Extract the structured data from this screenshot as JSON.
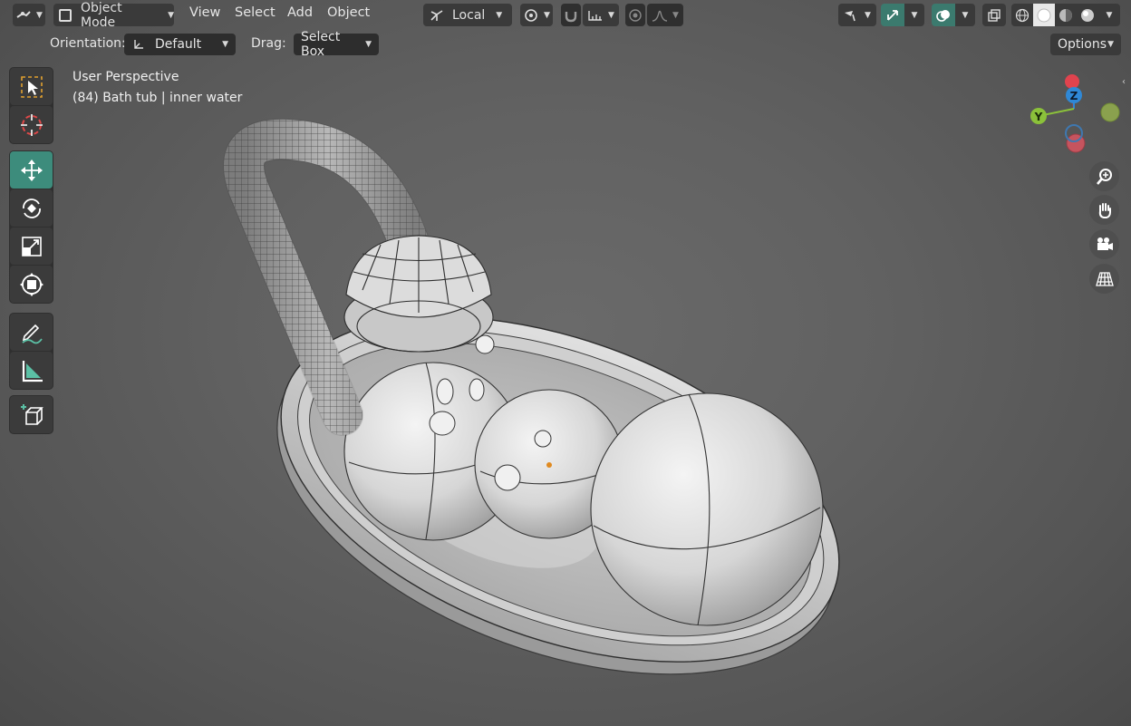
{
  "header": {
    "mode_label": "Object Mode",
    "menu": [
      "View",
      "Select",
      "Add",
      "Object"
    ],
    "transform_orientation": "Local",
    "options_label": "Options"
  },
  "toolsettings": {
    "orientation_label": "Orientation:",
    "orientation_value": "Default",
    "drag_label": "Drag:",
    "drag_value": "Select Box"
  },
  "viewport": {
    "view_name": "User Perspective",
    "object_info": "(84) Bath tub | inner water"
  },
  "gizmo": {
    "z_label": "Z",
    "y_label": "Y",
    "colors": {
      "x": "#e0434e",
      "y": "#8bc13a",
      "z": "#2f88d6"
    }
  },
  "toolbar": {
    "tools": [
      "select-box",
      "cursor",
      "move",
      "rotate",
      "scale",
      "transform",
      "annotate",
      "measure",
      "add-cube"
    ],
    "active": "move"
  },
  "colors": {
    "accent": "#3d8c7c",
    "header_bg": "#3a3a3a"
  }
}
